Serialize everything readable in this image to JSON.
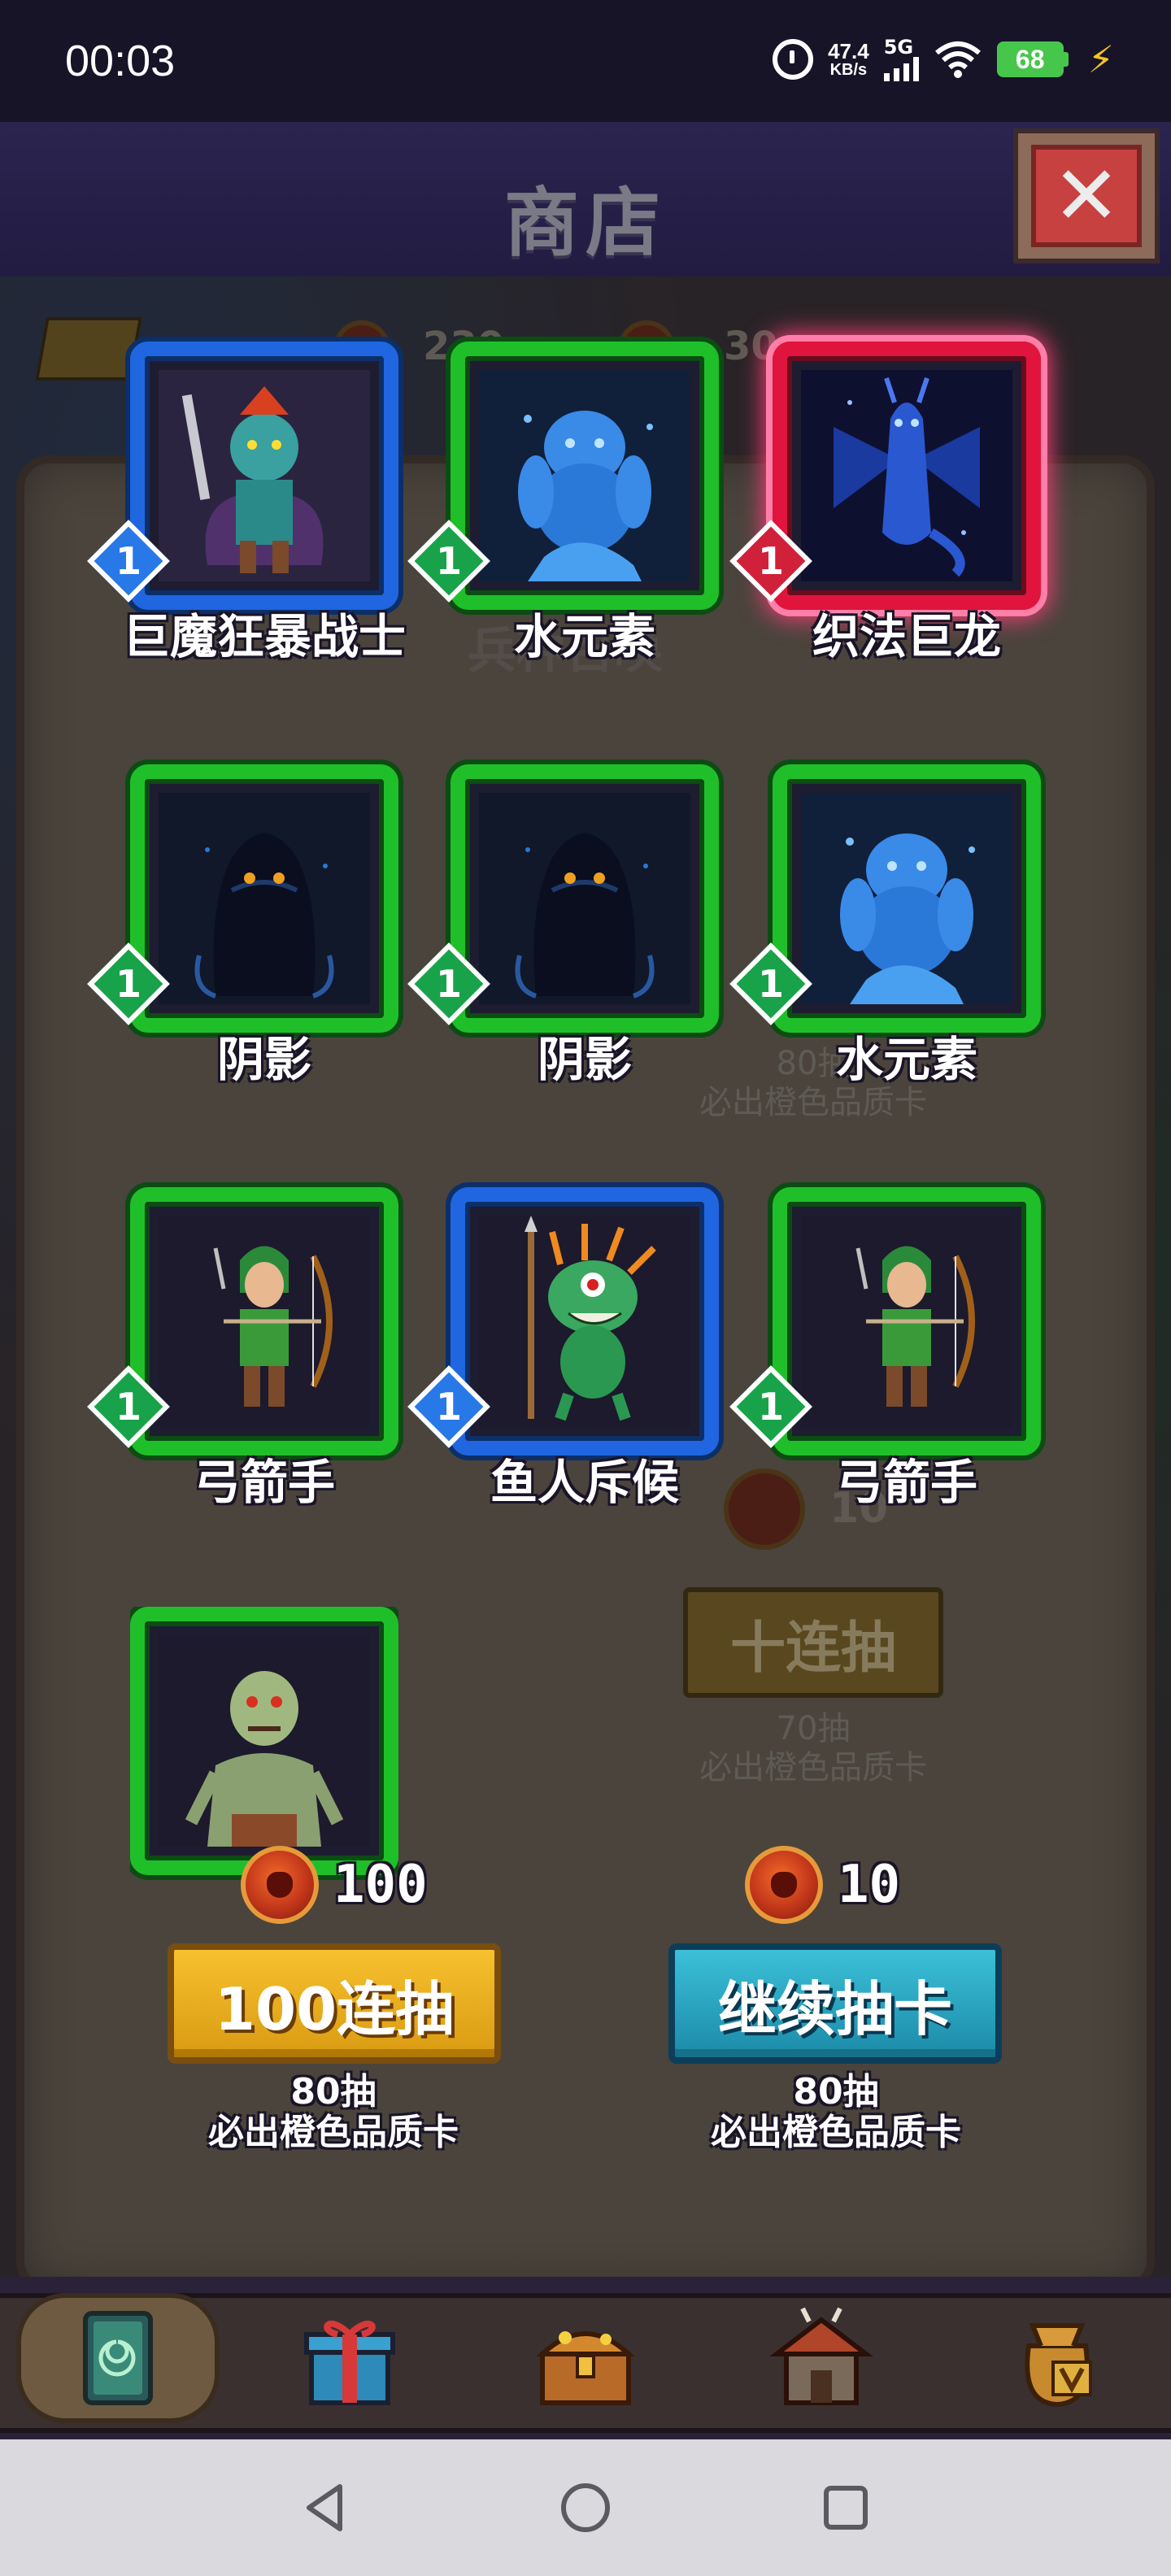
{
  "status_bar": {
    "time": "00:03",
    "net_speed_value": "47.4",
    "net_speed_unit": "KB/s",
    "network": "5G",
    "battery": "68",
    "icons": [
      "alarm-icon",
      "signal-icon",
      "wifi-icon",
      "battery-icon",
      "charging-bolt-icon"
    ]
  },
  "header": {
    "title": "商店",
    "close_icon": "close-icon"
  },
  "background": {
    "top_currency_a": "230",
    "top_currency_b": "30",
    "faint_label_1": "兵种召唤",
    "faint_note_1_line1": "80抽",
    "faint_note_1_line2": "必出橙色品质卡",
    "faint_cost": "10",
    "ten_draw_label": "十连抽",
    "faint_note_2_line1": "70抽",
    "faint_note_2_line2": "必出橙色品质卡"
  },
  "cards": [
    {
      "name": "巨魔狂暴战士",
      "level": "1",
      "rarity": "blue",
      "art": "troll-berserker"
    },
    {
      "name": "水元素",
      "level": "1",
      "rarity": "green",
      "art": "water-elemental"
    },
    {
      "name": "织法巨龙",
      "level": "1",
      "rarity": "red",
      "art": "arcane-dragon"
    },
    {
      "name": "阴影",
      "level": "1",
      "rarity": "green",
      "art": "shadow"
    },
    {
      "name": "阴影",
      "level": "1",
      "rarity": "green",
      "art": "shadow"
    },
    {
      "name": "水元素",
      "level": "1",
      "rarity": "green",
      "art": "water-elemental"
    },
    {
      "name": "弓箭手",
      "level": "1",
      "rarity": "green",
      "art": "archer"
    },
    {
      "name": "鱼人斥候",
      "level": "1",
      "rarity": "blue",
      "art": "murloc-scout"
    },
    {
      "name": "弓箭手",
      "level": "1",
      "rarity": "green",
      "art": "archer"
    },
    {
      "name": "",
      "level": "",
      "rarity": "green",
      "art": "ghoul"
    }
  ],
  "draw": {
    "hundred": {
      "cost": "100",
      "label": "100连抽",
      "note_line1": "80抽",
      "note_line2": "必出橙色品质卡"
    },
    "continue": {
      "cost": "10",
      "label": "继续抽卡",
      "note_line1": "80抽",
      "note_line2": "必出橙色品质卡"
    }
  },
  "bottom_nav": {
    "items": [
      "card-draw-icon",
      "gift-icon",
      "treasure-chest-icon",
      "tavern-icon",
      "vip-bag-icon"
    ],
    "active": "card-draw-icon"
  },
  "system_nav": [
    "back-icon",
    "home-icon",
    "recents-icon"
  ],
  "colors": {
    "rarity_green": "#1fbf2a",
    "rarity_blue": "#1f66e0",
    "rarity_red": "#e0143c",
    "button_yellow": "#f7c12e",
    "button_cyan": "#3cc0d8"
  }
}
